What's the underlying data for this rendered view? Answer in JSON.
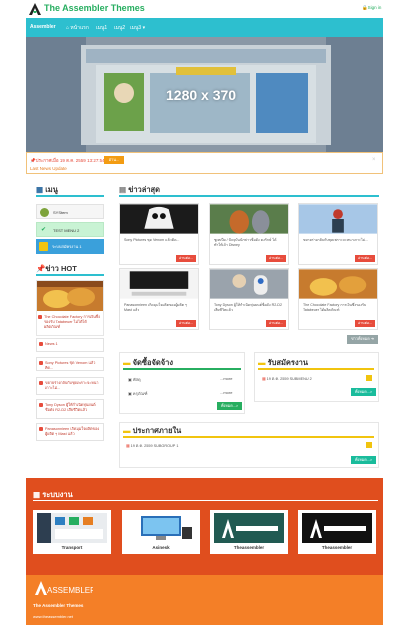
{
  "header": {
    "title": "The Assembler Themes",
    "signin": "Sign in"
  },
  "nav": {
    "brand": "Assembler",
    "items": [
      "หน้าแรก",
      "เมนู1",
      "เมนู2",
      "เมนู3 ▾"
    ]
  },
  "slider": {
    "label": "1280 x 370"
  },
  "newsbar": {
    "date_text": "ประกาศเมื่อ 19 ต.ค. 2559 13:27:54",
    "button": "อ่าน...",
    "latest": "Last News Update",
    "close": "×"
  },
  "sidebar": {
    "menu_title": "เมนู",
    "menu_items": [
      "SYStem",
      "TEST MENU 2",
      "ระบบสมัครงาน 1"
    ],
    "hot_title": "ข่าว HOT",
    "hot_items": [
      "The Chocolate Factory การเงินซึ่งรองรับ Tatabeuer ไม่ได้ได้ผลิตภัณฑ์",
      "News 1",
      "Sony Pictures ชุด Venom แล้วคิด...",
      "ขยายร่างกลับกับชุดเพราะจะหนาเกาะไม่...",
      "Tony Dyson ผู้ให้กำเนิดหุ่นยนต์ชื่อดัง R2-D2 เสียชีวิตแล้ว",
      "Panasonnieen เกิดมุมใจผลิตของผู้ผลิต ๆ Mast แล้ว"
    ]
  },
  "latest": {
    "title": "ข่าวล่าสุด",
    "read_more": "อ่านต่อ...",
    "cards": [
      "Sony Pictures ชุด Venom แล้วคิด...",
      "ซูเทเปีย / ปัจจุบันนักข่าวชื่อดัง คงรักษ์ ได้ทำให้เจ้า Disney",
      "ขยายร่างกลับกับชุดเพราะจะหนาเกาะไม่...",
      "Panasonnieen เกิดมุมใจผลิตของผู้ผลิต ๆ Mast แล้ว",
      "Tony Dyson ผู้ให้กำเนิดหุ่นยนต์ชื่อดัง R2-D2 เสียชีวิตแล้ว",
      "The Chocolate Factory การเงินซึ่งรองรับ Tatabeuer ได้ผลิตภัณฑ์"
    ],
    "all_button": "ข่าวทั้งหมด"
  },
  "procurement": {
    "title": "จัดซื้อจัดจ้าง",
    "rows": [
      {
        "name": "พัสดุ",
        "more": "...more"
      },
      {
        "name": "ครุภัณฑ์",
        "more": "...more"
      }
    ],
    "all_button": "ทั้งหมด...>"
  },
  "jobs": {
    "title": "รับสมัครงาน",
    "row": "19 ต.ค. 2559 SUBMENU 2",
    "all_button": "ทั้งหมด...>"
  },
  "announce": {
    "title": "ประกาศภายใน",
    "row": "19 ต.ค. 2559 SUBGROUP 1",
    "all_button": "ทั้งหมด...>"
  },
  "systems": {
    "title": "ระบบงาน",
    "items": [
      "Transport",
      "Asinesk",
      "Theassembler",
      "Theassembler"
    ]
  },
  "footer": {
    "logo_text": "ASSEMBLER",
    "name": "The Assembler Themes",
    "url": "www.theassembler.net"
  },
  "colors": {
    "accent": "#2dbfcf",
    "green": "#27ae60",
    "red": "#e74c3c",
    "system_bg": "#e04e1e",
    "footer_bg": "#f47f27"
  }
}
